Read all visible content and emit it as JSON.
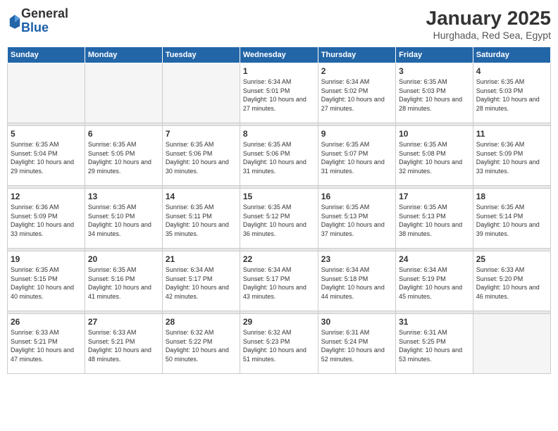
{
  "header": {
    "logo": {
      "general": "General",
      "blue": "Blue"
    },
    "title": "January 2025",
    "subtitle": "Hurghada, Red Sea, Egypt"
  },
  "weekdays": [
    "Sunday",
    "Monday",
    "Tuesday",
    "Wednesday",
    "Thursday",
    "Friday",
    "Saturday"
  ],
  "weeks": [
    [
      {
        "day": "",
        "sunrise": "",
        "sunset": "",
        "daylight": "",
        "empty": true
      },
      {
        "day": "",
        "sunrise": "",
        "sunset": "",
        "daylight": "",
        "empty": true
      },
      {
        "day": "",
        "sunrise": "",
        "sunset": "",
        "daylight": "",
        "empty": true
      },
      {
        "day": "1",
        "sunrise": "Sunrise: 6:34 AM",
        "sunset": "Sunset: 5:01 PM",
        "daylight": "Daylight: 10 hours and 27 minutes."
      },
      {
        "day": "2",
        "sunrise": "Sunrise: 6:34 AM",
        "sunset": "Sunset: 5:02 PM",
        "daylight": "Daylight: 10 hours and 27 minutes."
      },
      {
        "day": "3",
        "sunrise": "Sunrise: 6:35 AM",
        "sunset": "Sunset: 5:03 PM",
        "daylight": "Daylight: 10 hours and 28 minutes."
      },
      {
        "day": "4",
        "sunrise": "Sunrise: 6:35 AM",
        "sunset": "Sunset: 5:03 PM",
        "daylight": "Daylight: 10 hours and 28 minutes."
      }
    ],
    [
      {
        "day": "5",
        "sunrise": "Sunrise: 6:35 AM",
        "sunset": "Sunset: 5:04 PM",
        "daylight": "Daylight: 10 hours and 29 minutes."
      },
      {
        "day": "6",
        "sunrise": "Sunrise: 6:35 AM",
        "sunset": "Sunset: 5:05 PM",
        "daylight": "Daylight: 10 hours and 29 minutes."
      },
      {
        "day": "7",
        "sunrise": "Sunrise: 6:35 AM",
        "sunset": "Sunset: 5:06 PM",
        "daylight": "Daylight: 10 hours and 30 minutes."
      },
      {
        "day": "8",
        "sunrise": "Sunrise: 6:35 AM",
        "sunset": "Sunset: 5:06 PM",
        "daylight": "Daylight: 10 hours and 31 minutes."
      },
      {
        "day": "9",
        "sunrise": "Sunrise: 6:35 AM",
        "sunset": "Sunset: 5:07 PM",
        "daylight": "Daylight: 10 hours and 31 minutes."
      },
      {
        "day": "10",
        "sunrise": "Sunrise: 6:35 AM",
        "sunset": "Sunset: 5:08 PM",
        "daylight": "Daylight: 10 hours and 32 minutes."
      },
      {
        "day": "11",
        "sunrise": "Sunrise: 6:36 AM",
        "sunset": "Sunset: 5:09 PM",
        "daylight": "Daylight: 10 hours and 33 minutes."
      }
    ],
    [
      {
        "day": "12",
        "sunrise": "Sunrise: 6:36 AM",
        "sunset": "Sunset: 5:09 PM",
        "daylight": "Daylight: 10 hours and 33 minutes."
      },
      {
        "day": "13",
        "sunrise": "Sunrise: 6:35 AM",
        "sunset": "Sunset: 5:10 PM",
        "daylight": "Daylight: 10 hours and 34 minutes."
      },
      {
        "day": "14",
        "sunrise": "Sunrise: 6:35 AM",
        "sunset": "Sunset: 5:11 PM",
        "daylight": "Daylight: 10 hours and 35 minutes."
      },
      {
        "day": "15",
        "sunrise": "Sunrise: 6:35 AM",
        "sunset": "Sunset: 5:12 PM",
        "daylight": "Daylight: 10 hours and 36 minutes."
      },
      {
        "day": "16",
        "sunrise": "Sunrise: 6:35 AM",
        "sunset": "Sunset: 5:13 PM",
        "daylight": "Daylight: 10 hours and 37 minutes."
      },
      {
        "day": "17",
        "sunrise": "Sunrise: 6:35 AM",
        "sunset": "Sunset: 5:13 PM",
        "daylight": "Daylight: 10 hours and 38 minutes."
      },
      {
        "day": "18",
        "sunrise": "Sunrise: 6:35 AM",
        "sunset": "Sunset: 5:14 PM",
        "daylight": "Daylight: 10 hours and 39 minutes."
      }
    ],
    [
      {
        "day": "19",
        "sunrise": "Sunrise: 6:35 AM",
        "sunset": "Sunset: 5:15 PM",
        "daylight": "Daylight: 10 hours and 40 minutes."
      },
      {
        "day": "20",
        "sunrise": "Sunrise: 6:35 AM",
        "sunset": "Sunset: 5:16 PM",
        "daylight": "Daylight: 10 hours and 41 minutes."
      },
      {
        "day": "21",
        "sunrise": "Sunrise: 6:34 AM",
        "sunset": "Sunset: 5:17 PM",
        "daylight": "Daylight: 10 hours and 42 minutes."
      },
      {
        "day": "22",
        "sunrise": "Sunrise: 6:34 AM",
        "sunset": "Sunset: 5:17 PM",
        "daylight": "Daylight: 10 hours and 43 minutes."
      },
      {
        "day": "23",
        "sunrise": "Sunrise: 6:34 AM",
        "sunset": "Sunset: 5:18 PM",
        "daylight": "Daylight: 10 hours and 44 minutes."
      },
      {
        "day": "24",
        "sunrise": "Sunrise: 6:34 AM",
        "sunset": "Sunset: 5:19 PM",
        "daylight": "Daylight: 10 hours and 45 minutes."
      },
      {
        "day": "25",
        "sunrise": "Sunrise: 6:33 AM",
        "sunset": "Sunset: 5:20 PM",
        "daylight": "Daylight: 10 hours and 46 minutes."
      }
    ],
    [
      {
        "day": "26",
        "sunrise": "Sunrise: 6:33 AM",
        "sunset": "Sunset: 5:21 PM",
        "daylight": "Daylight: 10 hours and 47 minutes."
      },
      {
        "day": "27",
        "sunrise": "Sunrise: 6:33 AM",
        "sunset": "Sunset: 5:21 PM",
        "daylight": "Daylight: 10 hours and 48 minutes."
      },
      {
        "day": "28",
        "sunrise": "Sunrise: 6:32 AM",
        "sunset": "Sunset: 5:22 PM",
        "daylight": "Daylight: 10 hours and 50 minutes."
      },
      {
        "day": "29",
        "sunrise": "Sunrise: 6:32 AM",
        "sunset": "Sunset: 5:23 PM",
        "daylight": "Daylight: 10 hours and 51 minutes."
      },
      {
        "day": "30",
        "sunrise": "Sunrise: 6:31 AM",
        "sunset": "Sunset: 5:24 PM",
        "daylight": "Daylight: 10 hours and 52 minutes."
      },
      {
        "day": "31",
        "sunrise": "Sunrise: 6:31 AM",
        "sunset": "Sunset: 5:25 PM",
        "daylight": "Daylight: 10 hours and 53 minutes."
      },
      {
        "day": "",
        "sunrise": "",
        "sunset": "",
        "daylight": "",
        "empty": true
      }
    ]
  ]
}
